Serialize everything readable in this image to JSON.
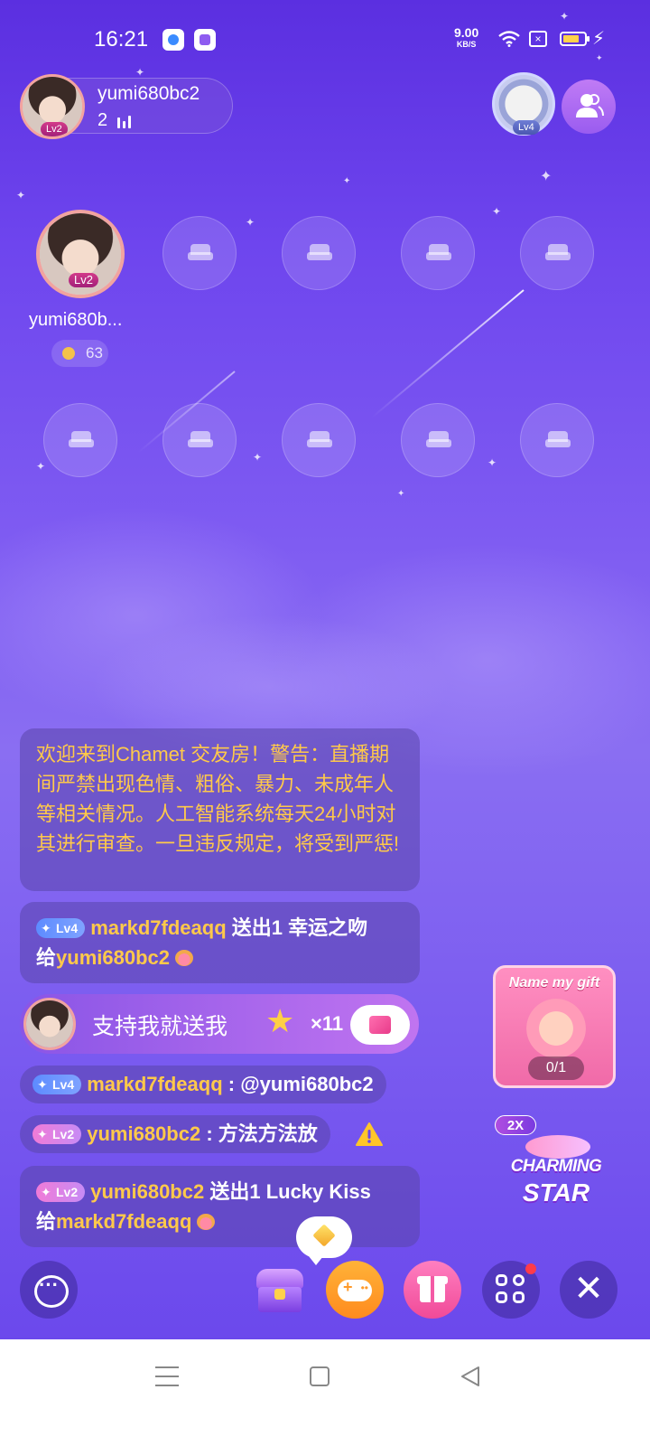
{
  "status_bar": {
    "time": "16:21",
    "net_speed_value": "9.00",
    "net_speed_unit": "KB/S",
    "battery_level": 0.7,
    "icons": [
      "app-notification-icon",
      "app-notification-icon",
      "wifi-icon",
      "no-sim-icon",
      "battery-icon",
      "charging-icon"
    ]
  },
  "host": {
    "name": "yumi680bc2",
    "level": "Lv2",
    "audience_count": "2",
    "rank_badge_level": "Lv4"
  },
  "seats": {
    "occupied": {
      "name": "yumi680b...",
      "level": "Lv2",
      "coins": "63"
    },
    "empty_seat_icon": "sofa-icon"
  },
  "chat": {
    "system_message": "欢迎来到Chamet 交友房！警告：直播期间严禁出现色情、粗俗、暴力、未成年人等相关情况。人工智能系统每天24小时对其进行审查。一旦违反规定，将受到严惩!",
    "gift1": {
      "level": "Lv4",
      "sender": "markd7fdeaqq",
      "action": "送出1 幸运之吻",
      "to_prefix": "给",
      "receiver": "yumi680bc2"
    },
    "promo": {
      "text": "支持我就送我",
      "count": "×11"
    },
    "mention": {
      "level": "Lv4",
      "sender": "markd7fdeaqq",
      "text": ": @yumi680bc2"
    },
    "message": {
      "level": "Lv2",
      "sender": "yumi680bc2",
      "text": ": 方法方法放"
    },
    "gift2": {
      "level": "Lv2",
      "sender": "yumi680bc2",
      "action": "送出1 Lucky Kiss",
      "to_prefix": "给",
      "receiver": "markd7fdeaqq"
    }
  },
  "side_promos": {
    "name_gift_title": "Name my gift",
    "name_gift_progress": "0/1",
    "charming_multiplier": "2X",
    "charming_line1": "CHARMING",
    "charming_line2": "STAR"
  },
  "colors": {
    "accent_gold": "#ffc94a",
    "background_purple": "#7b5cf0",
    "gift_pink": "#f04a98",
    "game_orange": "#ff8b1e"
  }
}
